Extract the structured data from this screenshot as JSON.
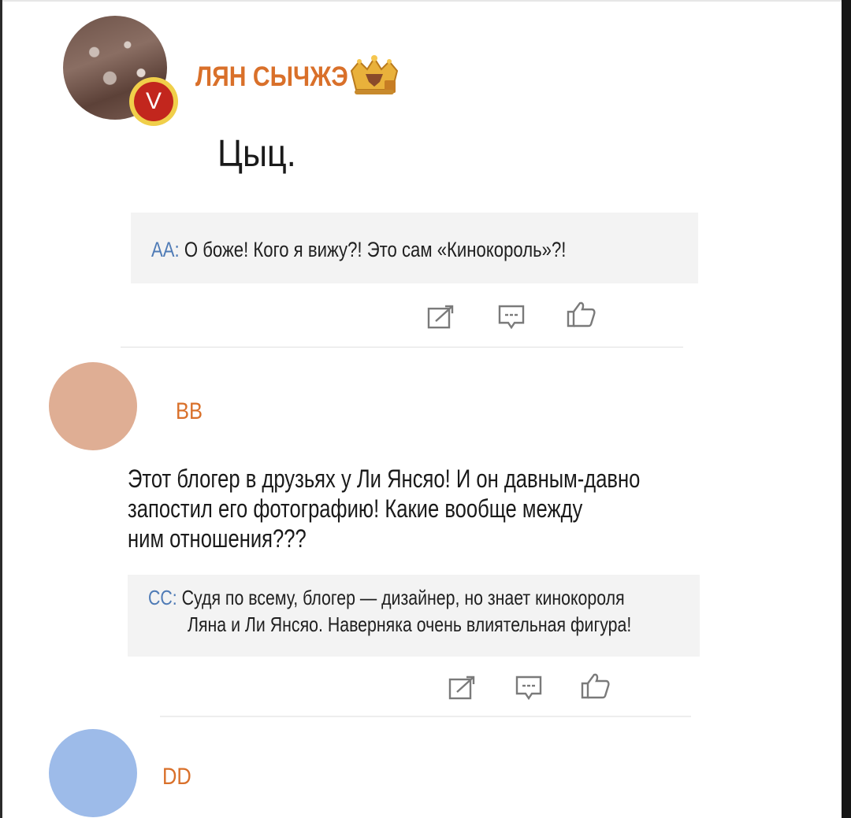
{
  "post": {
    "author_name": "ЛЯН СЫЧЖЭ",
    "badge_letter": "V",
    "text": "Цыц.",
    "reply": {
      "author": "АА",
      "separator": ":",
      "text": "О боже! Кого я вижу?! Это сам «Кинокороль»?!"
    },
    "actions": [
      "repost-icon",
      "comment-icon",
      "like-icon"
    ]
  },
  "comment": {
    "author_name": "BB",
    "lines": [
      "Этот блогер в друзьях у Ли Янсяо! И он давным-давно",
      "запостил его фотографию! Какие вообще между",
      "ним отношения???"
    ],
    "reply": {
      "author": "CC",
      "separator": ":",
      "lines": [
        "Судя по всему, блогер — дизайнер, но знает кинокороля",
        "Ляна и Ли Янсяо. Наверняка очень влиятельная фигура!"
      ]
    },
    "actions": [
      "repost-icon",
      "comment-icon",
      "like-icon"
    ]
  },
  "next_comment": {
    "author_name": "DD"
  },
  "colors": {
    "name": "#d9702a",
    "reply_author": "#4f7bb6",
    "reply_background": "#f3f3f3",
    "avatar_bb": "#dfae94",
    "avatar_dd": "#9dbbe9",
    "vip_badge": "#c2261d"
  }
}
